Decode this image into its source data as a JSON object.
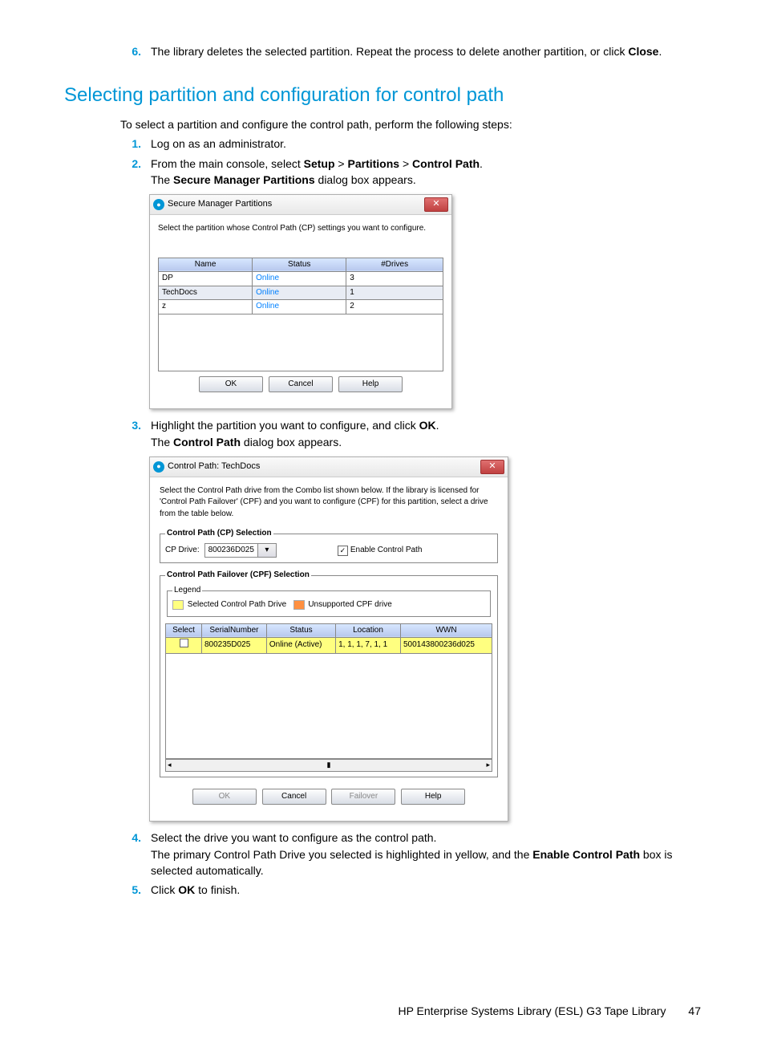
{
  "step6": {
    "num": "6.",
    "text_a": "The library deletes the selected partition. Repeat the process to delete another partition, or click ",
    "bold": "Close",
    "text_b": "."
  },
  "heading": "Selecting partition and configuration for control path",
  "intro": "To select a partition and configure the control path, perform the following steps:",
  "s1": {
    "num": "1.",
    "text": "Log on as an administrator."
  },
  "s2": {
    "num": "2.",
    "a": "From the main console, select ",
    "b1": "Setup",
    "gt1": " > ",
    "b2": "Partitions",
    "gt2": " > ",
    "b3": "Control Path",
    "dot": ".",
    "line2a": "The ",
    "line2b": "Secure Manager Partitions",
    "line2c": " dialog box appears."
  },
  "dlg1": {
    "title": "Secure Manager Partitions",
    "instr": "Select the partition whose Control Path (CP) settings you want to configure.",
    "cols": {
      "name": "Name",
      "status": "Status",
      "drives": "#Drives"
    },
    "rows": [
      {
        "name": "DP",
        "status": "Online",
        "drives": "3",
        "sel": false
      },
      {
        "name": "TechDocs",
        "status": "Online",
        "drives": "1",
        "sel": true
      },
      {
        "name": "z",
        "status": "Online",
        "drives": "2",
        "sel": false
      }
    ],
    "btn_ok": "OK",
    "btn_cancel": "Cancel",
    "btn_help": "Help"
  },
  "s3": {
    "num": "3.",
    "a": "Highlight the partition you want to configure, and click ",
    "b": "OK",
    "dot": ".",
    "line2a": "The ",
    "line2b": "Control Path",
    "line2c": " dialog box appears."
  },
  "dlg2": {
    "title": "Control Path: TechDocs",
    "instr": "Select the Control Path drive from the Combo list shown below. If the library is licensed for 'Control Path Failover' (CPF) and you want to configure (CPF) for this partition, select a drive from the table below.",
    "cp_legend": "Control Path (CP) Selection",
    "cp_label": "CP Drive:",
    "cp_value": "800236D025",
    "enable_cp": "Enable Control Path",
    "cpf_legend": "Control Path Failover (CPF) Selection",
    "legend_label": "Legend",
    "legend_selected": "Selected Control Path Drive",
    "legend_unsup": "Unsupported CPF drive",
    "cols": {
      "select": "Select",
      "sn": "SerialNumber",
      "status": "Status",
      "loc": "Location",
      "wwn": "WWN"
    },
    "row": {
      "sn": "800235D025",
      "status": "Online (Active)",
      "loc": "1, 1, 1, 7, 1, 1",
      "wwn": "500143800236d025"
    },
    "btn_ok": "OK",
    "btn_cancel": "Cancel",
    "btn_failover": "Failover",
    "btn_help": "Help"
  },
  "s4": {
    "num": "4.",
    "line1": "Select the drive you want to configure as the control path.",
    "line2a": "The primary Control Path Drive you selected is highlighted in yellow, and the ",
    "line2b": "Enable Control Path",
    "line2c": " box is selected automatically."
  },
  "s5": {
    "num": "5.",
    "a": "Click ",
    "b": "OK",
    "c": " to finish."
  },
  "footer": {
    "text": "HP Enterprise Systems Library (ESL) G3 Tape Library",
    "page": "47"
  }
}
